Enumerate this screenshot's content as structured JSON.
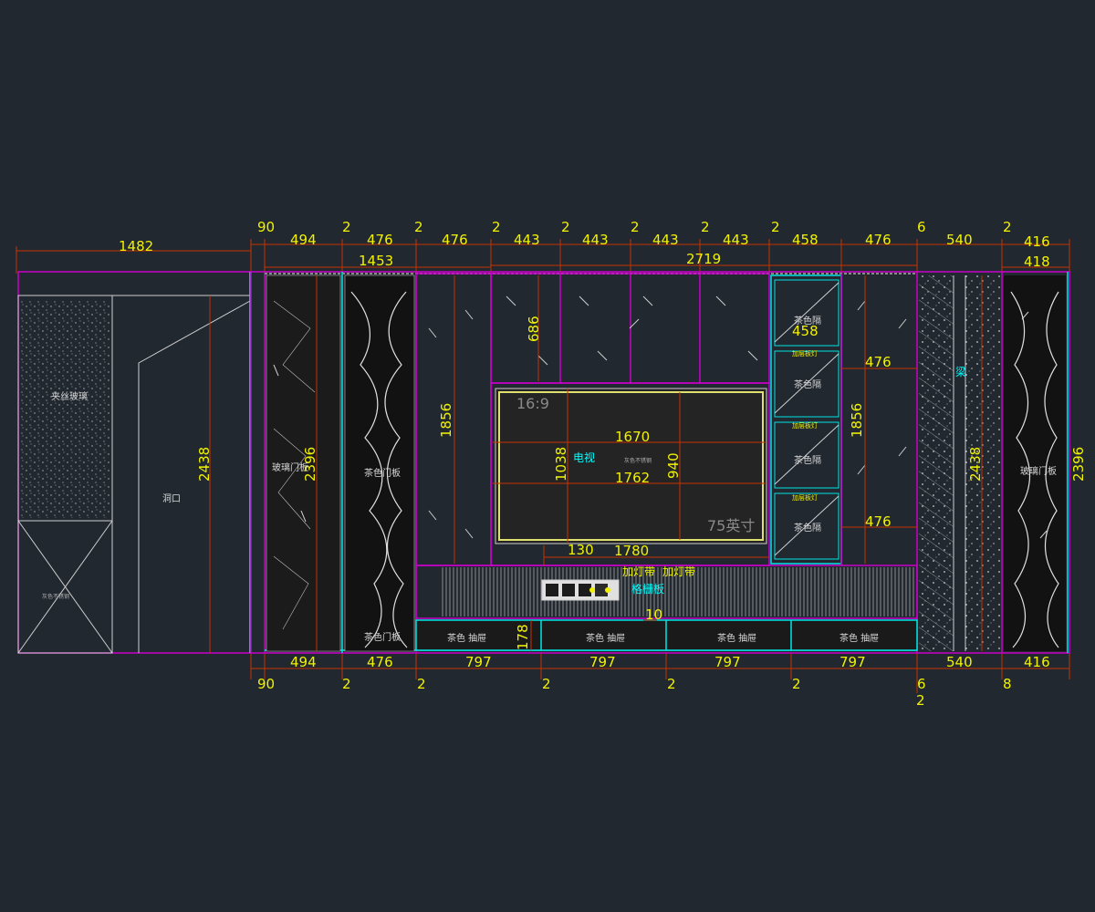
{
  "colors": {
    "background": "#212830",
    "magenta": "#c800c8",
    "cyan": "#00e5e5",
    "dimension_line": "#c83200",
    "dimension_text": "#f2f200",
    "tv_frame": "#e0e070",
    "white": "#cfcfcf"
  },
  "top_dims": {
    "row1": [
      {
        "id": "t90",
        "text": "90"
      },
      {
        "id": "t494",
        "text": "494"
      },
      {
        "id": "t2a",
        "text": "2"
      },
      {
        "id": "t476a",
        "text": "476"
      },
      {
        "id": "t2b",
        "text": "2"
      },
      {
        "id": "t476b",
        "text": "476"
      },
      {
        "id": "t2c",
        "text": "2"
      },
      {
        "id": "t443a",
        "text": "443"
      },
      {
        "id": "t2d",
        "text": "2"
      },
      {
        "id": "t443b",
        "text": "443"
      },
      {
        "id": "t2e",
        "text": "2"
      },
      {
        "id": "t443c",
        "text": "443"
      },
      {
        "id": "t2f",
        "text": "2"
      },
      {
        "id": "t443d",
        "text": "443"
      },
      {
        "id": "t2g",
        "text": "2"
      },
      {
        "id": "t458",
        "text": "458"
      },
      {
        "id": "t476c",
        "text": "476"
      },
      {
        "id": "t6",
        "text": "6"
      },
      {
        "id": "t540",
        "text": "540"
      },
      {
        "id": "t2h",
        "text": "2"
      },
      {
        "id": "t416",
        "text": "416"
      }
    ],
    "left_1482": "1482",
    "overall_1453": "1453",
    "overall_2719": "2719",
    "right_418": "418"
  },
  "bottom_dims": {
    "row1": [
      "494",
      "476",
      "797",
      "797",
      "797",
      "797",
      "540",
      "416"
    ],
    "row2": [
      "90",
      "2",
      "2",
      "2",
      "2",
      "2",
      "6",
      "8"
    ],
    "extra_2": "2"
  },
  "inner_dims": {
    "h686": "686",
    "h1856_left": "1856",
    "h1856_right": "1856",
    "h2396_left": "2396",
    "h2396_right": "2396",
    "h2438_left": "2438",
    "h2438_right": "2438",
    "w1670": "1670",
    "w1762": "1762",
    "h1038": "1038",
    "h940": "940",
    "w130": "130",
    "w1780": "1780",
    "w458": "458",
    "w476_a": "476",
    "w476_b": "476",
    "h178": "178",
    "d10": "10"
  },
  "labels": {
    "ratio": "16:9",
    "tv": "电视",
    "tv_size": "75英寸",
    "tv_note": "灰色不锈钢",
    "light_strip_1": "加灯带",
    "light_strip_2": "加灯带",
    "grille": "格栅板",
    "beam": "梁",
    "opening": "洞口",
    "door_glass_left": "玻璃门板",
    "door_glass_right": "玻璃门板",
    "door_color_1": "茶色门板",
    "door_color_2": "茶色门板",
    "tea_glass": "夹丝玻璃",
    "gray_steel": "灰色不锈钢",
    "drawer": "茶色 抽屉",
    "drawer_2": "茶色 抽屉",
    "drawer_3": "茶色 抽屉",
    "drawer_4": "茶色 抽屉",
    "shelf_1": "茶色隔",
    "shelf_2": "茶色隔",
    "shelf_3": "茶色隔",
    "shelf_4": "茶色隔",
    "glass_lamp_1": "加层板灯",
    "glass_lamp_2": "加层板灯",
    "glass_lamp_3": "加层板灯"
  }
}
